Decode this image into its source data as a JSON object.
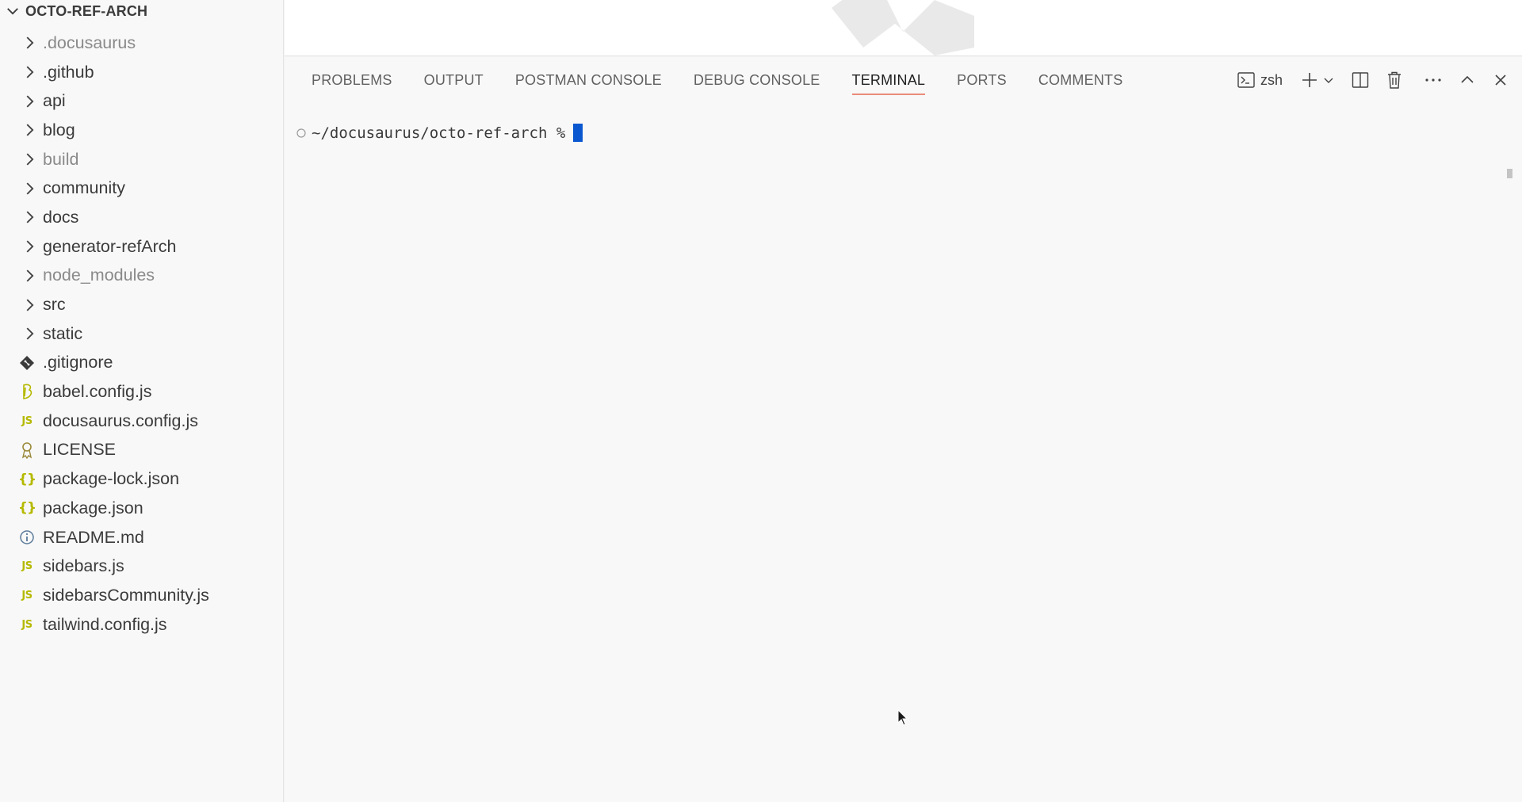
{
  "explorer": {
    "title": "OCTO-REF-ARCH",
    "items": [
      {
        "label": ".docusaurus",
        "kind": "folder",
        "dim": true
      },
      {
        "label": ".github",
        "kind": "folder",
        "dim": false
      },
      {
        "label": "api",
        "kind": "folder",
        "dim": false
      },
      {
        "label": "blog",
        "kind": "folder",
        "dim": false
      },
      {
        "label": "build",
        "kind": "folder",
        "dim": true
      },
      {
        "label": "community",
        "kind": "folder",
        "dim": false
      },
      {
        "label": "docs",
        "kind": "folder",
        "dim": false
      },
      {
        "label": "generator-refArch",
        "kind": "folder",
        "dim": false
      },
      {
        "label": "node_modules",
        "kind": "folder",
        "dim": true
      },
      {
        "label": "src",
        "kind": "folder",
        "dim": false
      },
      {
        "label": "static",
        "kind": "folder",
        "dim": false
      },
      {
        "label": ".gitignore",
        "kind": "file",
        "icon": "git-icon"
      },
      {
        "label": "babel.config.js",
        "kind": "file",
        "icon": "babel-icon"
      },
      {
        "label": "docusaurus.config.js",
        "kind": "file",
        "icon": "js-icon",
        "icon_text": "JS"
      },
      {
        "label": "LICENSE",
        "kind": "file",
        "icon": "license-icon"
      },
      {
        "label": "package-lock.json",
        "kind": "file",
        "icon": "json-icon",
        "icon_text": "{}"
      },
      {
        "label": "package.json",
        "kind": "file",
        "icon": "json-icon",
        "icon_text": "{}"
      },
      {
        "label": "README.md",
        "kind": "file",
        "icon": "info-icon"
      },
      {
        "label": "sidebars.js",
        "kind": "file",
        "icon": "js-icon",
        "icon_text": "JS"
      },
      {
        "label": "sidebarsCommunity.js",
        "kind": "file",
        "icon": "js-icon",
        "icon_text": "JS"
      },
      {
        "label": "tailwind.config.js",
        "kind": "file",
        "icon": "js-icon",
        "icon_text": "JS"
      }
    ]
  },
  "panel": {
    "tabs": [
      "PROBLEMS",
      "OUTPUT",
      "POSTMAN CONSOLE",
      "DEBUG CONSOLE",
      "TERMINAL",
      "PORTS",
      "COMMENTS"
    ],
    "active_tab": "TERMINAL",
    "shell_name": "zsh"
  },
  "terminal": {
    "prompt": "~/docusaurus/octo-ref-arch %"
  },
  "colors": {
    "active_tab_underline": "#e98c7b",
    "cursor": "#0b57d0",
    "js_icon": "#b5b900"
  }
}
